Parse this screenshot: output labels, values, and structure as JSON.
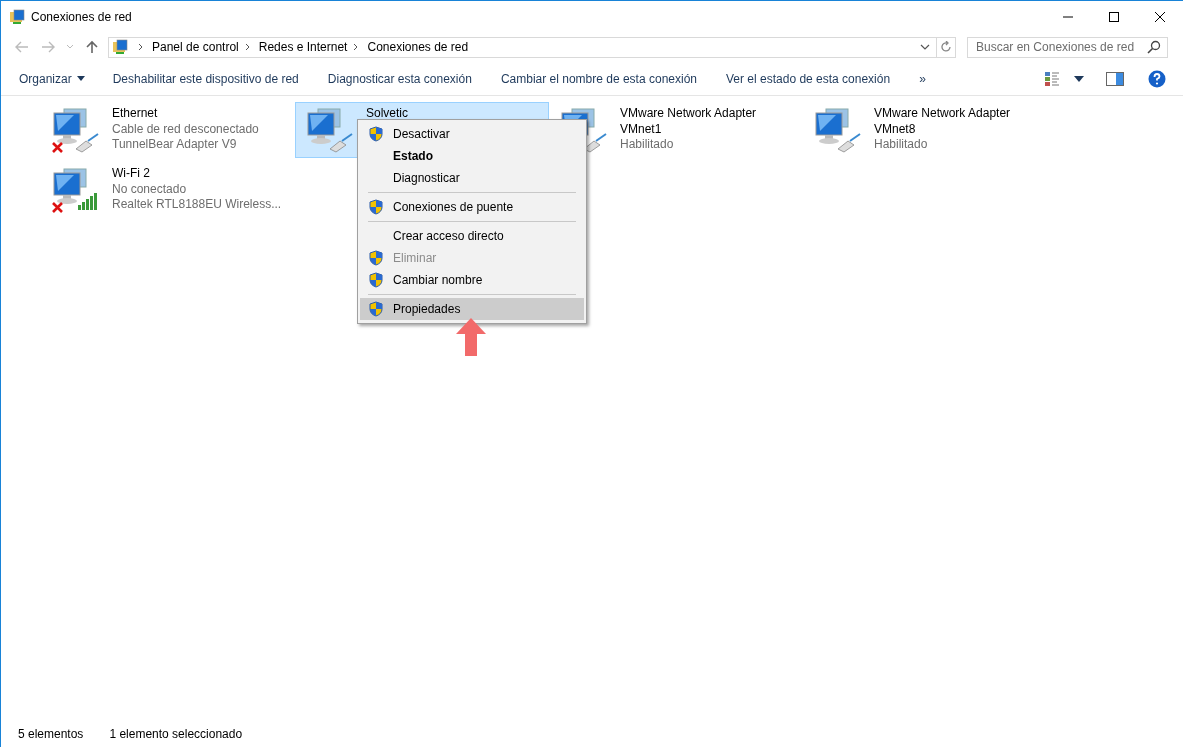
{
  "window": {
    "title": "Conexiones de red"
  },
  "breadcrumb": [
    "Panel de control",
    "Redes e Internet",
    "Conexiones de red"
  ],
  "search": {
    "placeholder": "Buscar en Conexiones de red"
  },
  "toolbar": [
    {
      "label": "Organizar",
      "dropdown": true
    },
    {
      "label": "Deshabilitar este dispositivo de red",
      "dropdown": false
    },
    {
      "label": "Diagnosticar esta conexión",
      "dropdown": false
    },
    {
      "label": "Cambiar el nombre de esta conexión",
      "dropdown": false
    },
    {
      "label": "Ver el estado de esta conexión",
      "dropdown": false
    },
    {
      "label": "»",
      "dropdown": false
    }
  ],
  "connections": [
    {
      "name": "Ethernet",
      "lines": [
        "Cable de red desconectado",
        "TunnelBear Adapter V9"
      ],
      "kind": "wired",
      "disconnected": true,
      "selected": false
    },
    {
      "name": "Solvetic",
      "kind": "wired",
      "disconnected": false,
      "selected": true
    },
    {
      "name": "VMware Network Adapter VMnet1",
      "lines": [
        "Habilitado"
      ],
      "kind": "wired",
      "selected": false
    },
    {
      "name": "VMware Network Adapter VMnet8",
      "lines": [
        "Habilitado"
      ],
      "kind": "wired",
      "disconnected": false,
      "selected": false
    },
    {
      "name": "Wi-Fi 2",
      "lines": [
        "No conectado",
        "Realtek RTL8188EU Wireless..."
      ],
      "kind": "wireless",
      "disconnected": true,
      "selected": false
    }
  ],
  "context_menu": [
    {
      "kind": "item",
      "label": "Desactivar",
      "shield": true,
      "default": false,
      "disabled": false,
      "selected": false
    },
    {
      "kind": "item",
      "label": "Estado",
      "shield": false,
      "default": true,
      "disabled": false,
      "selected": false
    },
    {
      "kind": "item",
      "label": "Diagnosticar",
      "shield": false,
      "default": false,
      "disabled": false,
      "selected": false
    },
    {
      "kind": "separator"
    },
    {
      "kind": "item",
      "label": "Conexiones de puente",
      "shield": true,
      "default": false,
      "disabled": false,
      "selected": false
    },
    {
      "kind": "separator"
    },
    {
      "kind": "item",
      "label": "Crear acceso directo",
      "shield": false,
      "default": false,
      "disabled": false,
      "selected": false
    },
    {
      "kind": "item",
      "label": "Eliminar",
      "shield": true,
      "default": false,
      "disabled": true,
      "selected": false
    },
    {
      "kind": "item",
      "label": "Cambiar nombre",
      "shield": true,
      "default": false,
      "disabled": false,
      "selected": false
    },
    {
      "kind": "separator"
    },
    {
      "kind": "item",
      "label": "Propiedades",
      "shield": true,
      "default": false,
      "disabled": false,
      "selected": true
    }
  ],
  "status_bar": [
    "5 elementos",
    "1 elemento seleccionado"
  ]
}
